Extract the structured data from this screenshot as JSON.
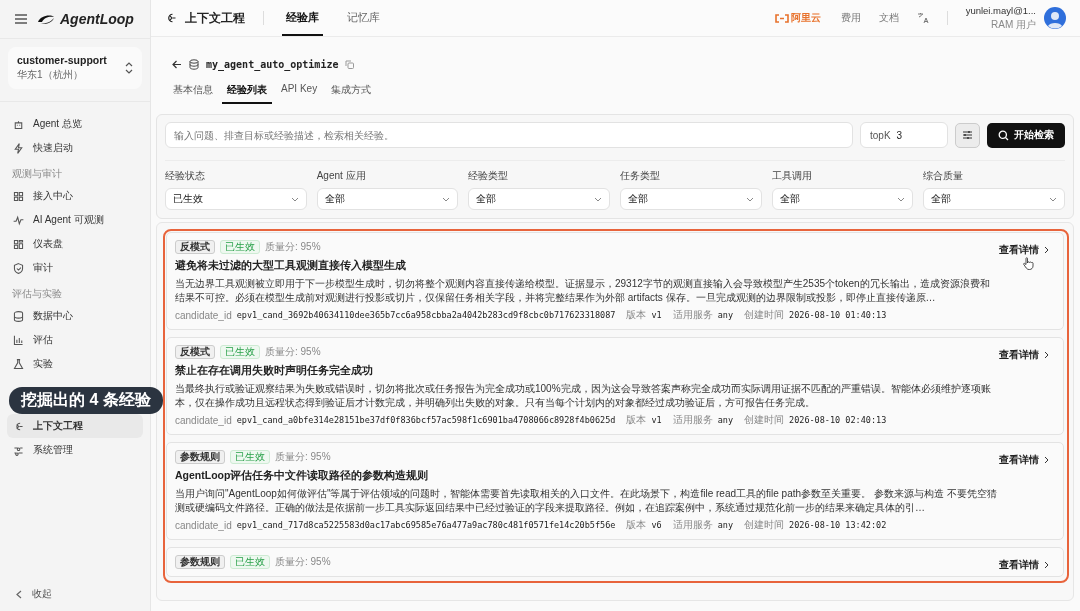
{
  "app": {
    "name": "AgentLoop"
  },
  "project": {
    "name": "customer-support",
    "region": "华东1（杭州）"
  },
  "sidebar": {
    "sections": [
      {
        "items": [
          {
            "label": "Agent 总览",
            "selected": false
          },
          {
            "label": "快速启动",
            "selected": false
          }
        ]
      },
      {
        "title": "观测与审计",
        "items": [
          {
            "label": "接入中心",
            "selected": false
          },
          {
            "label": "AI Agent 可观测",
            "selected": false
          },
          {
            "label": "仪表盘",
            "selected": false
          },
          {
            "label": "审计",
            "selected": false
          }
        ]
      },
      {
        "title": "评估与实验",
        "items": [
          {
            "label": "数据中心",
            "selected": false
          },
          {
            "label": "评估",
            "selected": false
          },
          {
            "label": "实验",
            "selected": false
          }
        ]
      },
      {
        "items": [
          {
            "label": "上下文工程",
            "selected": true
          },
          {
            "label": "系统管理",
            "selected": false
          }
        ]
      }
    ],
    "collapse": "收起"
  },
  "topbar": {
    "section": "上下文工程",
    "tabs": [
      {
        "label": "经验库",
        "selected": true
      },
      {
        "label": "记忆库",
        "selected": false
      }
    ],
    "brand": "阿里云",
    "links": [
      "费用",
      "文档"
    ],
    "user": {
      "email": "yunlei.mayl@1...",
      "role": "RAM 用户"
    }
  },
  "library": {
    "name": "my_agent_auto_optimize",
    "tabs": [
      {
        "label": "基本信息",
        "selected": false
      },
      {
        "label": "经验列表",
        "selected": true
      },
      {
        "label": "API Key",
        "selected": false
      },
      {
        "label": "集成方式",
        "selected": false
      }
    ]
  },
  "search": {
    "placeholder": "输入问题、排查目标或经验描述，检索相关经验。",
    "topk_label": "topK",
    "topk_value": "3",
    "button": "开始检索"
  },
  "filters": [
    {
      "label": "经验状态",
      "value": "已生效"
    },
    {
      "label": "Agent 应用",
      "value": "全部"
    },
    {
      "label": "经验类型",
      "value": "全部"
    },
    {
      "label": "任务类型",
      "value": "全部"
    },
    {
      "label": "工具调用",
      "value": "全部"
    },
    {
      "label": "综合质量",
      "value": "全部"
    }
  ],
  "experiences": [
    {
      "type": "反模式",
      "status": "已生效",
      "score": "质量分: 95%",
      "title": "避免将未过滤的大型工具观测直接传入模型生成",
      "description": "当无边界工具观测被立即用于下一步模型生成时，切勿将整个观测内容直接传递给模型。证据显示，29312字节的观测直接输入会导致模型产生2535个token的冗长输出，造成资源浪费和结果不可控。必须在模型生成前对观测进行投影或切片，仅保留任务相关字段，并将完整结果作为外部 artifacts 保存。一旦完成观测的边界限制或投影，即停止直接传递原…",
      "meta": [
        {
          "label": "candidate_id",
          "value": "epv1_cand_3692b40634110dee365b7cc6a958cbba2a4042b283cd9f8cbc0b717623318087"
        },
        {
          "label": "版本",
          "value": "v1"
        },
        {
          "label": "适用服务",
          "value": "any"
        },
        {
          "label": "创建时间",
          "value": "2026-08-10 01:40:13"
        }
      ],
      "link": "查看详情",
      "hovered": true
    },
    {
      "type": "反模式",
      "status": "已生效",
      "score": "质量分: 95%",
      "title": "禁止在存在调用失败时声明任务完全成功",
      "description": "当最终执行或验证观察结果为失败或错误时，切勿将批次或任务报告为完全成功或100%完成，因为这会导致答案声称完全成功而实际调用证据不匹配的严重错误。智能体必须维护逐项账本，仅在操作成功且远程状态得到验证后才计数完成，并明确列出失败的对象。只有当每个计划内的对象都经过成功验证后，方可报告任务完成。",
      "meta": [
        {
          "label": "candidate_id",
          "value": "epv1_cand_a0bfe314e28151be37df0f836bcf57ac598f1c6901ba4708066c8928f4b0625d"
        },
        {
          "label": "版本",
          "value": "v1"
        },
        {
          "label": "适用服务",
          "value": "any"
        },
        {
          "label": "创建时间",
          "value": "2026-08-10 02:40:13"
        }
      ],
      "link": "查看详情",
      "hovered": false
    },
    {
      "type": "参数规则",
      "status": "已生效",
      "score": "质量分: 95%",
      "title": "AgentLoop评估任务中文件读取路径的参数构造规则",
      "description": "当用户询问\"AgentLoop如何做评估\"等属于评估领域的问题时，智能体需要首先读取相关的入口文件。在此场景下，构造file read工具的file path参数至关重要。 参数来源与构造 不要凭空猜测或硬编码文件路径。正确的做法是依据前一步工具实际返回结果中已经过验证的字段来提取路径。例如，在追踪案例中，系统通过规范化前一步的结果来确定具体的引…",
      "meta": [
        {
          "label": "candidate_id",
          "value": "epv1_cand_717d8ca5225583d0ac17abc69585e76a477a9ac780c481f0571fe14c20b5f56e"
        },
        {
          "label": "版本",
          "value": "v6"
        },
        {
          "label": "适用服务",
          "value": "any"
        },
        {
          "label": "创建时间",
          "value": "2026-08-10 13:42:02"
        }
      ],
      "link": "查看详情",
      "hovered": false
    },
    {
      "type": "参数规则",
      "status": "已生效",
      "score": "质量分: 95%",
      "link": "查看详情",
      "hovered": false
    }
  ],
  "caption": "挖掘出的 4 条经验"
}
